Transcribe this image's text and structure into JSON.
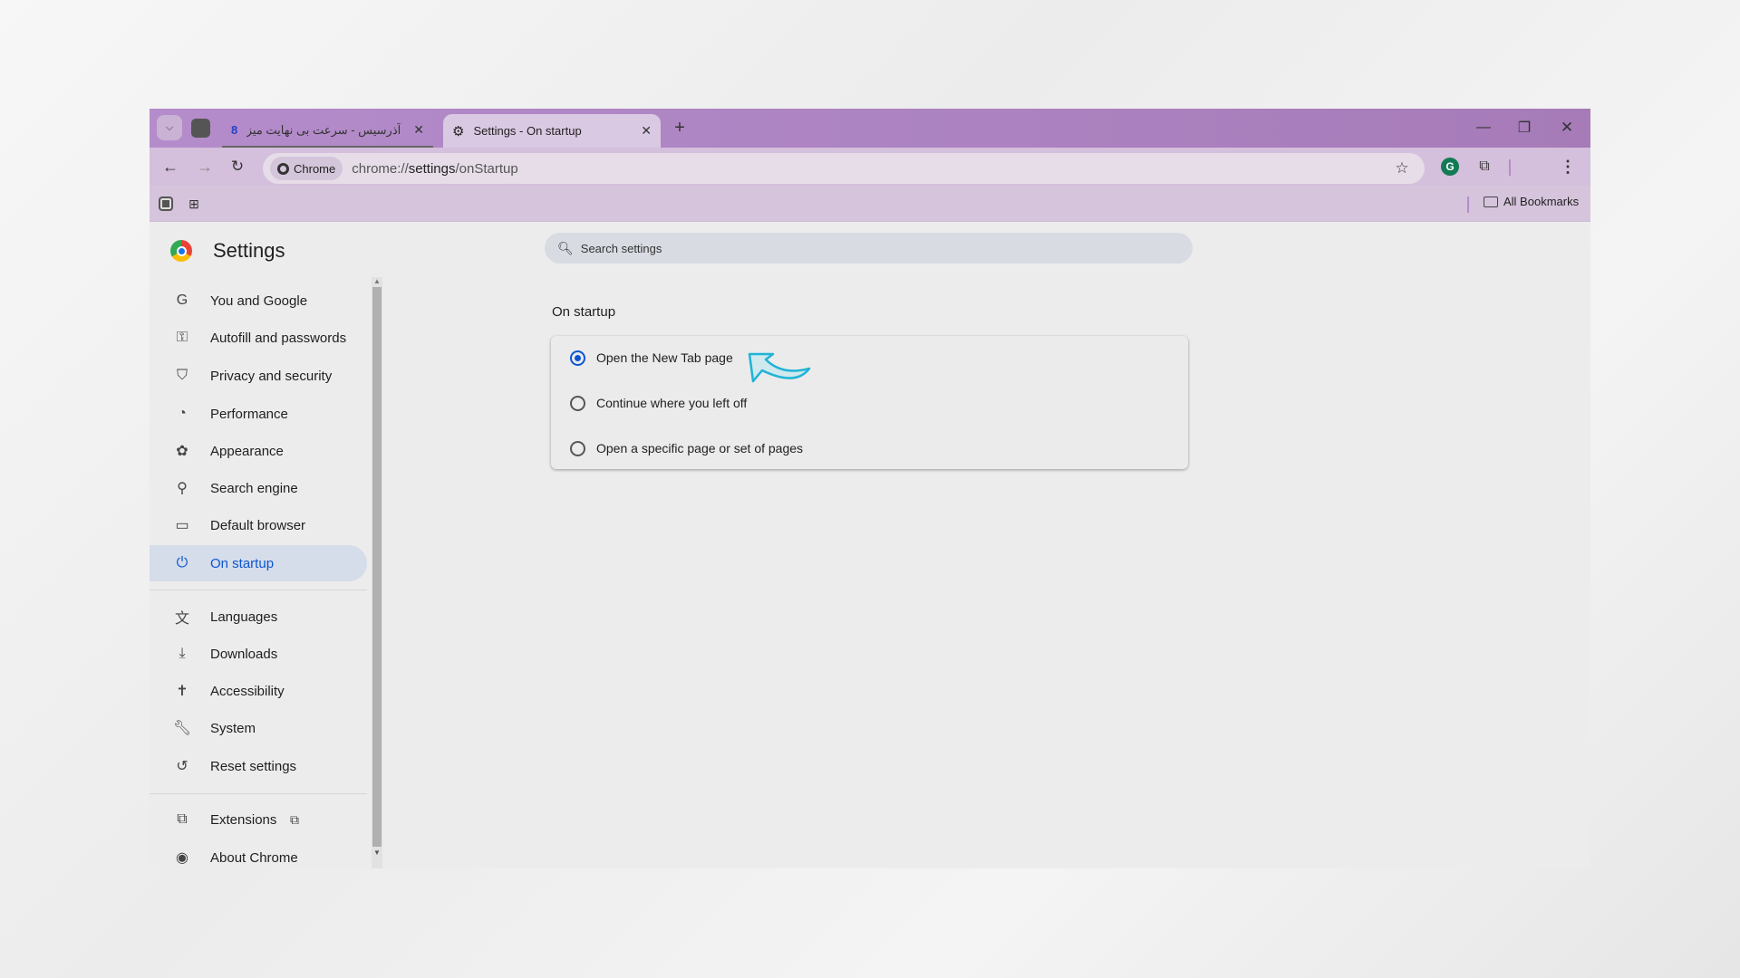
{
  "browser": {
    "tabs": [
      {
        "title": "آذرسیس - سرعت بی نهایت میزبان",
        "active": false
      },
      {
        "title": "Settings - On startup",
        "active": true
      }
    ],
    "omnibox": {
      "chip": "Chrome",
      "url_prefix": "chrome://",
      "url_bold": "settings",
      "url_suffix": "/onStartup"
    },
    "bookmarks": {
      "all_label": "All Bookmarks"
    },
    "colors": {
      "tabstrip": "#a67bb8",
      "toolbar": "#d4bfdc",
      "accent": "#0b57d0"
    }
  },
  "settings": {
    "title": "Settings",
    "search_placeholder": "Search settings",
    "sidebar": [
      {
        "label": "You and Google",
        "icon": "google-g-icon"
      },
      {
        "label": "Autofill and passwords",
        "icon": "key-icon"
      },
      {
        "label": "Privacy and security",
        "icon": "shield-icon"
      },
      {
        "label": "Performance",
        "icon": "speedometer-icon"
      },
      {
        "label": "Appearance",
        "icon": "palette-icon"
      },
      {
        "label": "Search engine",
        "icon": "search-icon"
      },
      {
        "label": "Default browser",
        "icon": "browser-window-icon"
      },
      {
        "label": "On startup",
        "icon": "power-icon",
        "active": true
      },
      {
        "label": "Languages",
        "icon": "translate-icon"
      },
      {
        "label": "Downloads",
        "icon": "download-icon"
      },
      {
        "label": "Accessibility",
        "icon": "accessibility-icon"
      },
      {
        "label": "System",
        "icon": "wrench-icon"
      },
      {
        "label": "Reset settings",
        "icon": "reset-icon"
      },
      {
        "label": "Extensions",
        "icon": "puzzle-icon"
      },
      {
        "label": "About Chrome",
        "icon": "chrome-icon"
      }
    ],
    "section_title": "On startup",
    "options": [
      {
        "label": "Open the New Tab page",
        "selected": true
      },
      {
        "label": "Continue where you left off",
        "selected": false
      },
      {
        "label": "Open a specific page or set of pages",
        "selected": false
      }
    ]
  }
}
